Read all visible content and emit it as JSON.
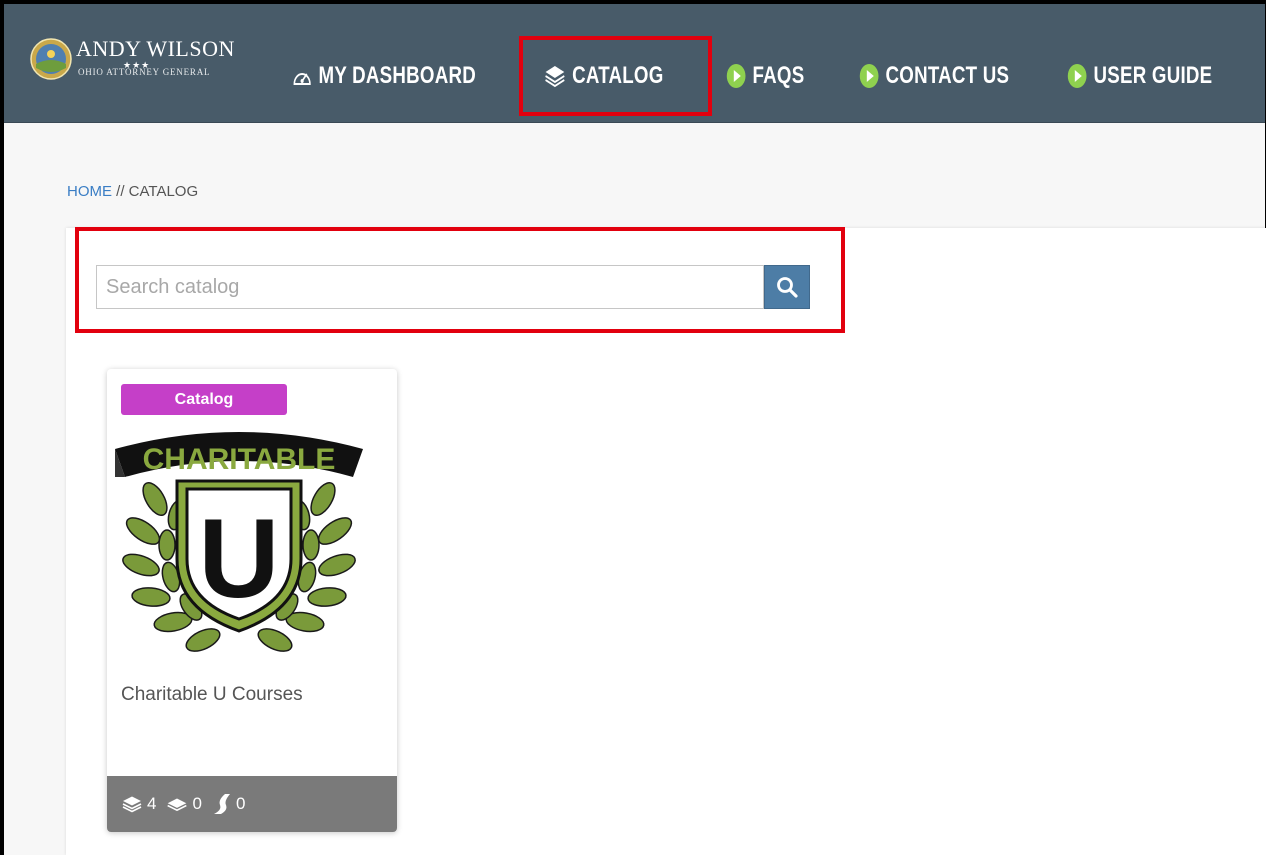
{
  "header": {
    "logo_name": "ANDY WILSON",
    "logo_subtitle": "Ohio Attorney General",
    "nav": {
      "dashboard": "MY DASHBOARD",
      "catalog": "CATALOG",
      "faqs": "FAQS",
      "contact": "CONTACT US",
      "guide": "USER GUIDE"
    }
  },
  "breadcrumb": {
    "home": "HOME",
    "separator": " // ",
    "current": "CATALOG"
  },
  "search": {
    "placeholder": "Search catalog"
  },
  "card": {
    "badge": "Catalog",
    "logo_text": "CHARITABLE",
    "logo_letter": "U",
    "title": "Charitable U Courses",
    "stats": {
      "courses": "4",
      "lessons": "0",
      "paths": "0"
    }
  },
  "colors": {
    "header_bg": "#485b69",
    "highlight": "#e2000e",
    "badge": "#c53fc8",
    "search_button": "#4d7da6",
    "laurel": "#7a9a3a"
  }
}
